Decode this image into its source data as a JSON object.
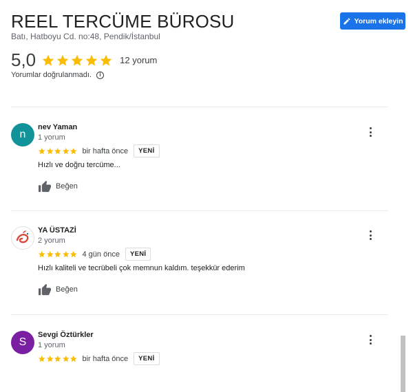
{
  "header": {
    "title": "REEL TERCÜME BÜROSU",
    "address": "Batı, Hatboyu Cd. no:48, Pendik/İstanbul",
    "write_review_label": "Yorum ekleyin"
  },
  "summary": {
    "rating": "5,0",
    "stars": 5,
    "review_count": "12 yorum",
    "unverified_text": "Yorumlar doğrulanmadı.",
    "info_icon": "i"
  },
  "colors": {
    "accent": "#1a73e8",
    "star": "#fbbc04",
    "avatar_teal": "#12939a",
    "avatar_purple": "#7b1fa2"
  },
  "reviews": [
    {
      "avatar_letter": "n",
      "author": "nev Yaman",
      "review_count": "1 yorum",
      "stars": 5,
      "time": "bir hafta önce",
      "badge": "YENİ",
      "text": "Hızlı ve doğru tercüme...",
      "like_label": "Beğen"
    },
    {
      "avatar_letter": "",
      "author": "YA ÜSTAZİ",
      "review_count": "2 yorum",
      "stars": 5,
      "time": "4 gün önce",
      "badge": "YENİ",
      "text": "Hızlı kaliteli ve tecrübeli çok memnun kaldım. teşekkür ederim",
      "like_label": "Beğen"
    },
    {
      "avatar_letter": "S",
      "author": "Sevgi Öztürkler",
      "review_count": "1 yorum",
      "stars": 5,
      "time": "bir hafta önce",
      "badge": "YENİ",
      "text": "",
      "like_label": ""
    }
  ]
}
